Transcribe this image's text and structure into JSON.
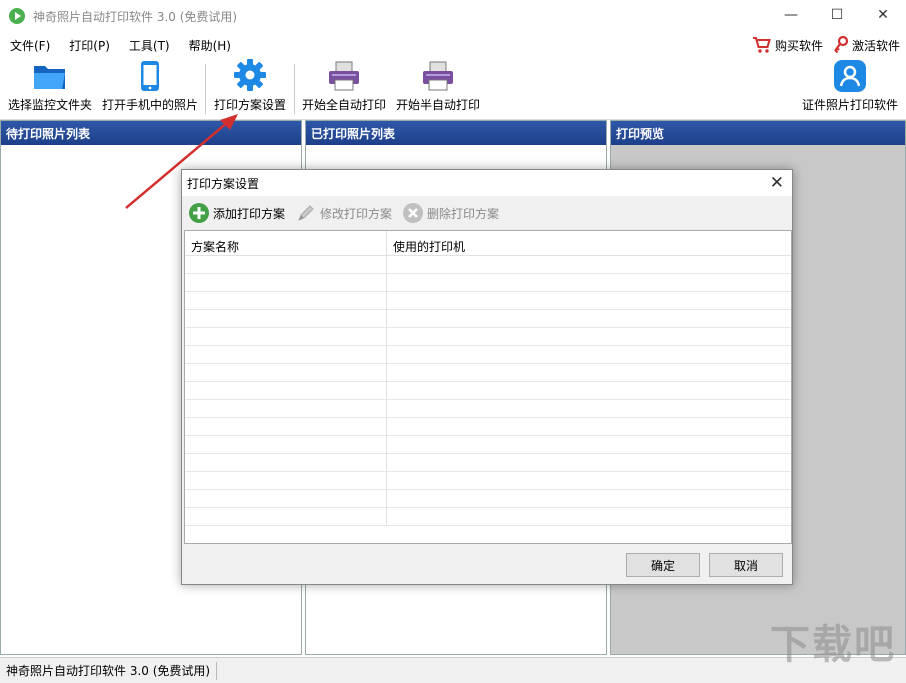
{
  "window": {
    "title": "神奇照片自动打印软件 3.0 (免费试用)",
    "controls": {
      "minimize": "—",
      "maximize": "☐",
      "close": "✕"
    }
  },
  "menu": {
    "items": [
      "文件(F)",
      "打印(P)",
      "工具(T)",
      "帮助(H)"
    ],
    "right": {
      "buy": "购买软件",
      "activate": "激活软件"
    }
  },
  "toolbar": {
    "select_folder": "选择监控文件夹",
    "phone_photos": "打开手机中的照片",
    "print_scheme": "打印方案设置",
    "auto_print": "开始全自动打印",
    "semi_auto_print": "开始半自动打印",
    "id_photo": "证件照片打印软件"
  },
  "panels": {
    "pending": "待打印照片列表",
    "printed": "已打印照片列表",
    "preview": "打印预览"
  },
  "dialog": {
    "title": "打印方案设置",
    "close": "✕",
    "toolbar": {
      "add": "添加打印方案",
      "edit": "修改打印方案",
      "delete": "删除打印方案"
    },
    "columns": [
      "方案名称",
      "使用的打印机"
    ],
    "ok": "确定",
    "cancel": "取消"
  },
  "status": {
    "text": "神奇照片自动打印软件 3.0 (免费试用)"
  },
  "watermark": "下载吧",
  "colors": {
    "panel_header": "#2f58a8",
    "accent_blue": "#1e88e5",
    "arrow_red": "#d32f2f"
  }
}
